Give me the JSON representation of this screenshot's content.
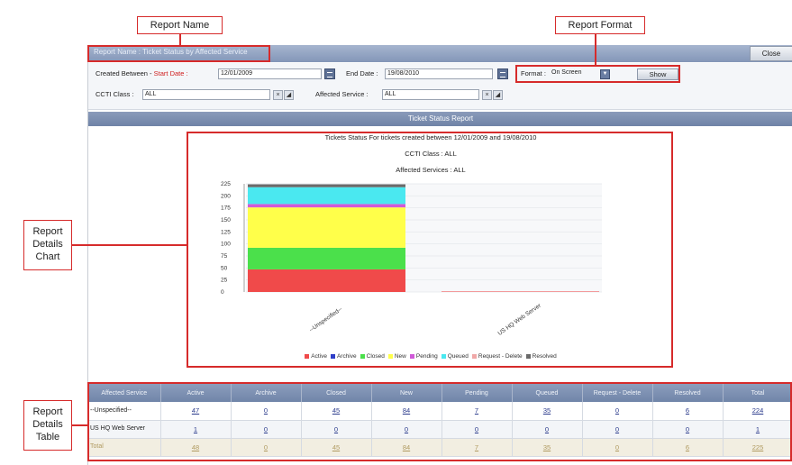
{
  "annotations": {
    "report_name": "Report Name",
    "report_format": "Report Format",
    "details_chart": [
      "Report",
      "Details",
      "Chart"
    ],
    "details_table": [
      "Report",
      "Details",
      "Table"
    ]
  },
  "window": {
    "title": "Report Name : Ticket Status by Affected Service",
    "close_label": "Close"
  },
  "filters": {
    "created_between_label": "Created Between -",
    "start_date_label": "Start Date :",
    "start_date_value": "12/01/2009",
    "end_date_label": "End Date :",
    "end_date_value": "19/08/2010",
    "format_label": "Format :",
    "format_value": "On Screen",
    "show_label": "Show",
    "ccti_label": "CCTI Class :",
    "ccti_value": "ALL",
    "affected_label": "Affected Service :",
    "affected_value": "ALL"
  },
  "status_bar": "Ticket Status Report",
  "chart_data": {
    "type": "bar",
    "stacked": true,
    "title": "Tickets Status For tickets created between 12/01/2009 and 19/08/2010",
    "subtitle_1": "CCTI Class : ALL",
    "subtitle_2": "Affected Services : ALL",
    "categories": [
      "--Unspecified--",
      "US HQ Web Server"
    ],
    "ylim": [
      0,
      225
    ],
    "yticks": [
      "225",
      "200",
      "175",
      "150",
      "125",
      "100",
      "75",
      "50",
      "25",
      "0"
    ],
    "series": [
      {
        "name": "Active",
        "color": "#f04a4a",
        "values": [
          47,
          1
        ]
      },
      {
        "name": "Archive",
        "color": "#2f3fc8",
        "values": [
          0,
          0
        ]
      },
      {
        "name": "Closed",
        "color": "#4be04b",
        "values": [
          45,
          0
        ]
      },
      {
        "name": "New",
        "color": "#ffff4a",
        "values": [
          84,
          0
        ]
      },
      {
        "name": "Pending",
        "color": "#d05ad8",
        "values": [
          7,
          0
        ]
      },
      {
        "name": "Queued",
        "color": "#4ae8f0",
        "values": [
          35,
          0
        ]
      },
      {
        "name": "Request - Delete",
        "color": "#f0a8a8",
        "values": [
          0,
          0
        ]
      },
      {
        "name": "Resolved",
        "color": "#6a6a6a",
        "values": [
          6,
          0
        ]
      }
    ]
  },
  "table": {
    "headers": [
      "Affected Service",
      "Active",
      "Archive",
      "Closed",
      "New",
      "Pending",
      "Queued",
      "Request - Delete",
      "Resolved",
      "Total"
    ],
    "rows": [
      [
        "--Unspecified--",
        "47",
        "0",
        "45",
        "84",
        "7",
        "35",
        "0",
        "6",
        "224"
      ],
      [
        "US HQ Web Server",
        "1",
        "0",
        "0",
        "0",
        "0",
        "0",
        "0",
        "0",
        "1"
      ],
      [
        "Total",
        "48",
        "0",
        "45",
        "84",
        "7",
        "35",
        "0",
        "6",
        "225"
      ]
    ]
  }
}
